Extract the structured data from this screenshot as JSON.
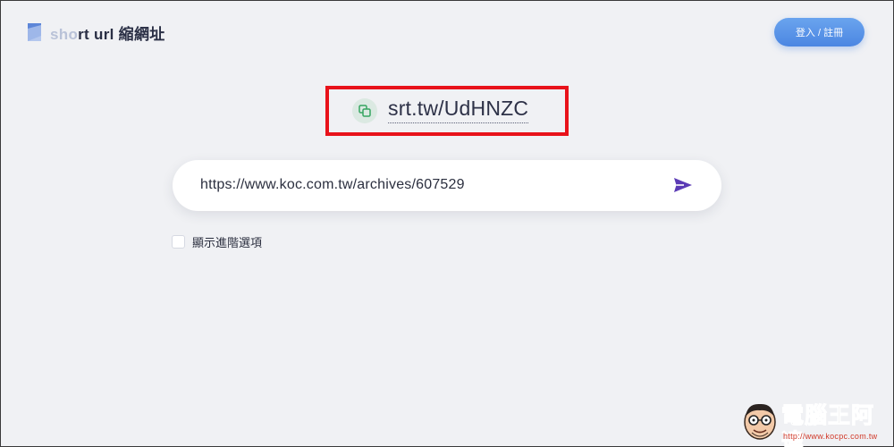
{
  "header": {
    "logo_text_dim": "sho",
    "logo_text_main": "rt url 縮網址",
    "login_label": "登入 / 註冊"
  },
  "result": {
    "short_url": "srt.tw/UdHNZC",
    "copy_icon": "copy-icon"
  },
  "url_input": {
    "value": "https://www.koc.com.tw/archives/607529",
    "send_icon": "send-icon"
  },
  "options": {
    "advanced_label": "顯示進階選項",
    "advanced_checked": false
  },
  "watermark": {
    "title": "電腦王阿達",
    "url": "http://www.kocpc.com.tw"
  },
  "colors": {
    "background": "#f0f1f4",
    "login_button": "#4b86e2",
    "highlight_box": "#e8121a",
    "send_icon": "#5b3bb5",
    "copy_icon": "#36a561"
  }
}
